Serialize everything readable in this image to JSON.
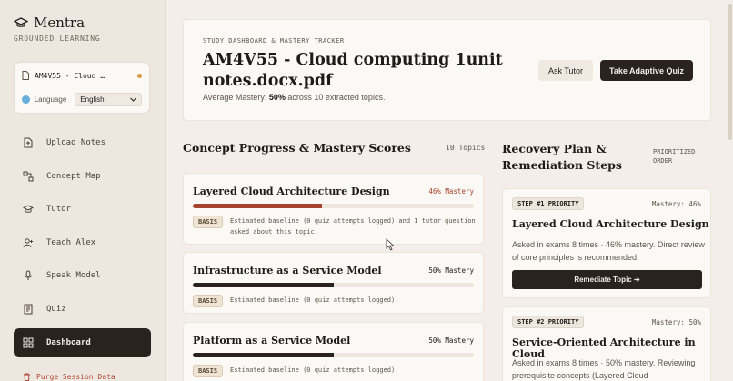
{
  "brand": {
    "title": "Mentra",
    "subtitle": "GROUNDED LEARNING"
  },
  "session": {
    "name": "AM4V55 - Cloud …",
    "language_label": "Language",
    "language_value": "English"
  },
  "nav": [
    {
      "label": "Upload Notes",
      "icon": "upload-icon"
    },
    {
      "label": "Concept Map",
      "icon": "concept-map-icon"
    },
    {
      "label": "Tutor",
      "icon": "mortarboard-icon"
    },
    {
      "label": "Teach Alex",
      "icon": "person-icon"
    },
    {
      "label": "Speak Model",
      "icon": "microphone-icon"
    },
    {
      "label": "Quiz",
      "icon": "quiz-icon"
    },
    {
      "label": "Dashboard",
      "icon": "dashboard-icon",
      "active": true
    }
  ],
  "purge_label": "Purge Session Data",
  "header": {
    "kicker": "STUDY DASHBOARD & MASTERY TRACKER",
    "title": "AM4V55 - Cloud computing 1unit notes.docx.pdf",
    "mastery_prefix": "Average Mastery: ",
    "mastery_value": "50%",
    "mastery_suffix": " across 10 extracted topics.",
    "ask_tutor": "Ask Tutor",
    "take_quiz": "Take Adaptive Quiz"
  },
  "progress": {
    "title": "Concept Progress & Mastery Scores",
    "count": "10 Topics",
    "topics": [
      {
        "name": "Layered Cloud Architecture Design",
        "score": "46% Mastery",
        "fill": 0.46,
        "badge": "BASIS",
        "basis": "Estimated baseline (0 quiz attempts logged) and 1 tutor question asked about this topic."
      },
      {
        "name": "Infrastructure as a Service Model",
        "score": "50% Mastery",
        "fill": 0.5,
        "badge": "BASIS",
        "basis": "Estimated baseline (0 quiz attempts logged)."
      },
      {
        "name": "Platform as a Service Model",
        "score": "50% Mastery",
        "fill": 0.5,
        "badge": "BASIS",
        "basis": "Estimated baseline (0 quiz attempts logged)."
      }
    ]
  },
  "recovery": {
    "title": "Recovery Plan & Remediation Steps",
    "order_label": "PRIORITIZED ORDER",
    "items": [
      {
        "priority": "STEP #1 PRIORITY",
        "mastery": "Mastery: 46%",
        "name": "Layered Cloud Architecture Design",
        "desc": "Asked in exams 8 times · 46% mastery. Direct review of core principles is recommended.",
        "button": "Remediate Topic ➜"
      },
      {
        "priority": "STEP #2 PRIORITY",
        "mastery": "Mastery: 50%",
        "name": "Service-Oriented Architecture in Cloud",
        "desc": "Asked in exams 8 times · 50% mastery. Reviewing prerequisite concepts (Layered Cloud"
      }
    ]
  },
  "colors": {
    "accent_dark": "#2a221d",
    "low_mastery": "#a5442e",
    "background": "#f3eee7",
    "status_dot": "#d99a43"
  }
}
